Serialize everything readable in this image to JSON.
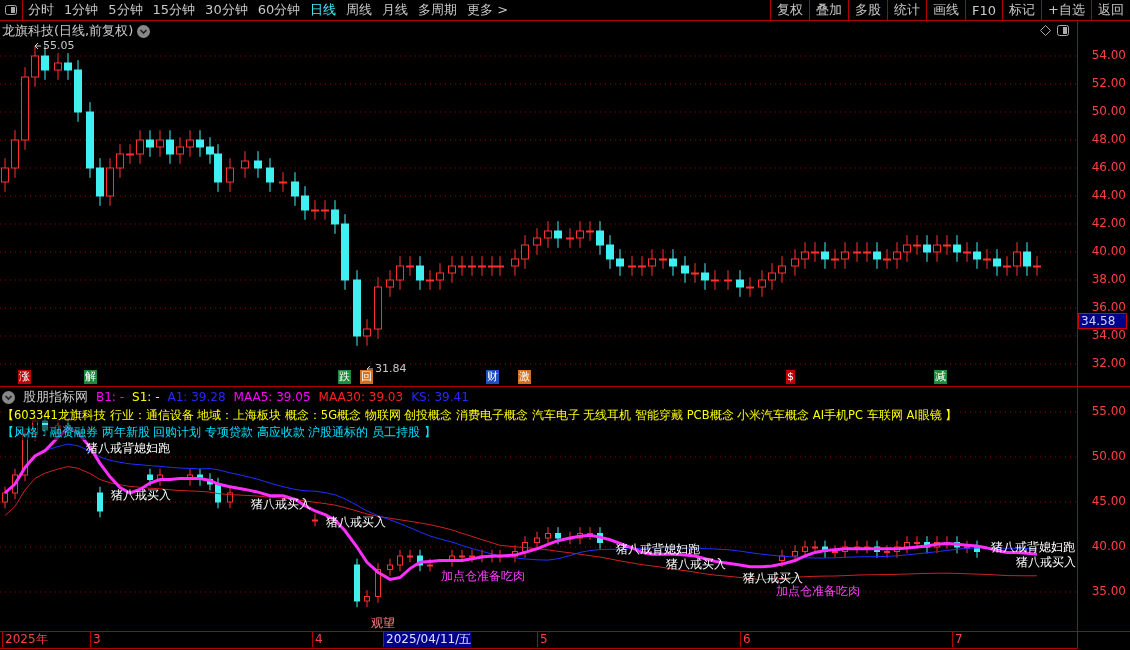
{
  "toolbar": {
    "periods": [
      {
        "label": "分时",
        "selected": false
      },
      {
        "label": "1分钟",
        "selected": false
      },
      {
        "label": "5分钟",
        "selected": false
      },
      {
        "label": "15分钟",
        "selected": false
      },
      {
        "label": "30分钟",
        "selected": false
      },
      {
        "label": "60分钟",
        "selected": false
      },
      {
        "label": "日线",
        "selected": true
      },
      {
        "label": "周线",
        "selected": false
      },
      {
        "label": "月线",
        "selected": false
      },
      {
        "label": "多周期",
        "selected": false
      },
      {
        "label": "更多 >",
        "selected": false
      }
    ],
    "buttons": [
      "复权",
      "叠加",
      "多股",
      "统计",
      "画线",
      "F10",
      "标记",
      "+自选",
      "返回"
    ]
  },
  "price_panel": {
    "title": "龙旗科技(日线,前复权)",
    "high_label": "55.05",
    "low_label": "31.84",
    "current_price": "34.58",
    "y_axis_labels": [
      "54.00",
      "52.00",
      "50.00",
      "48.00",
      "46.00",
      "44.00",
      "42.00",
      "40.00",
      "38.00",
      "36.00",
      "34.00",
      "32.00"
    ],
    "event_markers": [
      {
        "label": "涨",
        "color": "#c00000"
      },
      {
        "label": "解",
        "color": "#1e8a3c"
      },
      {
        "label": "跌",
        "color": "#1e8a3c"
      },
      {
        "label": "回",
        "color": "#d07020"
      },
      {
        "label": "财",
        "color": "#2050c0"
      },
      {
        "label": "激",
        "color": "#d07020"
      },
      {
        "label": "$",
        "color": "#c00000"
      },
      {
        "label": "减",
        "color": "#1e8a3c"
      }
    ]
  },
  "indicator_panel": {
    "name": "股朋指标网",
    "legend": [
      {
        "text": "B1: -",
        "color": "#ff00ff"
      },
      {
        "text": "S1: -",
        "color": "#ffff00"
      },
      {
        "text": "A1: 39.28",
        "color": "#2828ff"
      },
      {
        "text": "MAA5: 39.05",
        "color": "#ff00ff"
      },
      {
        "text": "MAA30: 39.03",
        "color": "#ff2020"
      },
      {
        "text": "KS: 39.41",
        "color": "#2828ff"
      }
    ],
    "info_lines": [
      {
        "text": "【603341龙旗科技 行业：通信设备 地域：上海板块 概念：5G概念 物联网 创投概念 消费电子概念 汽车电子 无线耳机 智能穿戴 PCB概念 小米汽车概念 AI手机PC 车联网 AI眼镜 】",
        "color": "#ffff00"
      },
      {
        "text": "【风格：融资融券 两年新股 回购计划 专项贷款 高应收款 沪股通标的 员工持股 】",
        "color": "#00e0ff"
      }
    ],
    "signals": [
      {
        "text": "猪八戒背媳妇跑",
        "kind": "sell"
      },
      {
        "text": "猪八戒买入",
        "kind": "buy"
      },
      {
        "text": "猪八戒买入",
        "kind": "buy"
      },
      {
        "text": "猪八戒买入",
        "kind": "buy"
      },
      {
        "text": "加点仓准备吃肉",
        "kind": "add"
      },
      {
        "text": "猪八戒背媳妇跑",
        "kind": "sell"
      },
      {
        "text": "猪八戒买入",
        "kind": "buy"
      },
      {
        "text": "猪八戒买入",
        "kind": "buy"
      },
      {
        "text": "加点仓准备吃肉",
        "kind": "add"
      },
      {
        "text": "猪八戒背媳妇跑",
        "kind": "sell"
      },
      {
        "text": "猪八戒买入",
        "kind": "buy"
      },
      {
        "text": "观望",
        "kind": "watch"
      }
    ],
    "y_axis_labels": [
      "55.00",
      "50.00",
      "45.00",
      "40.00",
      "35.00"
    ]
  },
  "time_axis": {
    "labels": [
      {
        "text": "2025年",
        "selected": false
      },
      {
        "text": "3",
        "selected": false
      },
      {
        "text": "4",
        "selected": false
      },
      {
        "text": "2025/04/11/五",
        "selected": true
      },
      {
        "text": "5",
        "selected": false
      },
      {
        "text": "6",
        "selected": false
      },
      {
        "text": "7",
        "selected": false
      }
    ]
  }
}
